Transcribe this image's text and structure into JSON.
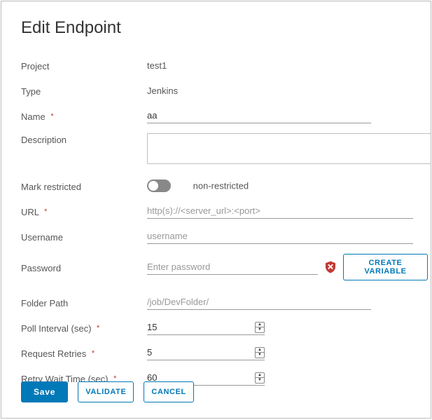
{
  "title": "Edit Endpoint",
  "labels": {
    "project": "Project",
    "type": "Type",
    "name": "Name",
    "description": "Description",
    "mark_restricted": "Mark restricted",
    "url": "URL",
    "username": "Username",
    "password": "Password",
    "folder_path": "Folder Path",
    "poll_interval": "Poll Interval (sec)",
    "request_retries": "Request Retries",
    "retry_wait_time": "Retry Wait Time (sec)"
  },
  "values": {
    "project": "test1",
    "type": "Jenkins",
    "name": "aa",
    "description": "",
    "restricted_state": "non-restricted",
    "poll_interval": "15",
    "request_retries": "5",
    "retry_wait_time": "60"
  },
  "placeholders": {
    "url": "http(s)://<server_url>:<port>",
    "username": "username",
    "password": "Enter password",
    "folder_path": "/job/DevFolder/"
  },
  "buttons": {
    "create_variable": "Create Variable",
    "save": "Save",
    "validate": "Validate",
    "cancel": "Cancel"
  },
  "required_marker": "*",
  "colors": {
    "primary": "#0079b8",
    "danger": "#c23934"
  }
}
